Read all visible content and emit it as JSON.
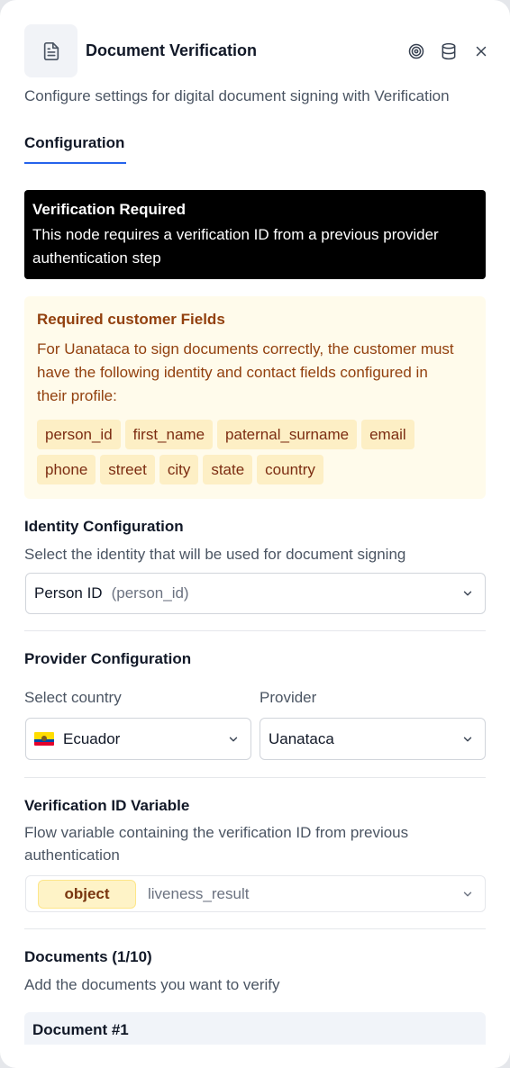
{
  "header": {
    "title": "Document Verification",
    "subtitle": "Configure settings for digital document signing with Verification",
    "icons": [
      "document-icon",
      "target-icon",
      "database-icon",
      "close-icon"
    ]
  },
  "tabs": [
    {
      "label": "Configuration",
      "active": true
    }
  ],
  "alert": {
    "title": "Verification Required",
    "text": "This node requires a verification ID from a previous provider authentication step"
  },
  "required_fields": {
    "title": "Required customer Fields",
    "text": "For Uanataca to sign documents correctly, the customer must have the following identity and contact fields configured in their profile:",
    "chips": [
      "person_id",
      "first_name",
      "paternal_surname",
      "email",
      "phone",
      "street",
      "city",
      "state",
      "country"
    ]
  },
  "identity": {
    "title": "Identity Configuration",
    "description": "Select the identity that will be used for document signing",
    "selected_label": "Person ID",
    "selected_key": "(person_id)"
  },
  "provider": {
    "title": "Provider Configuration",
    "country_label": "Select country",
    "country_value": "Ecuador",
    "provider_label": "Provider",
    "provider_value": "Uanataca"
  },
  "verification_variable": {
    "title": "Verification ID Variable",
    "description": "Flow variable containing the verification ID from previous authentication",
    "type_badge": "object",
    "value": "liveness_result"
  },
  "documents": {
    "title": "Documents (1/10)",
    "description": "Add the documents you want to verify",
    "items": [
      {
        "label": "Document #1"
      }
    ]
  },
  "colors": {
    "accent": "#2563eb",
    "alert_bg": "#000000",
    "warning_bg": "#fffbeb",
    "warning_text": "#92400e",
    "chip_bg": "#fdefc5"
  }
}
